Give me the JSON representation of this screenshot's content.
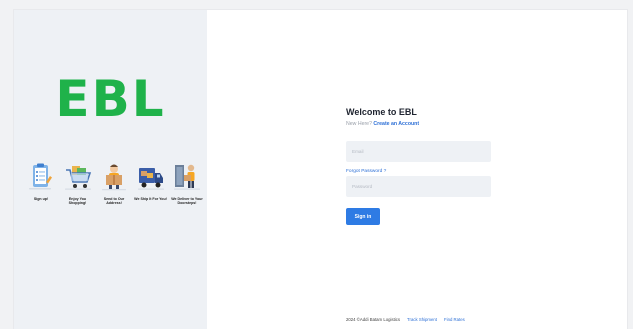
{
  "brand": {
    "logo_text": "EBL",
    "accent": "#1fb24a"
  },
  "steps": [
    {
      "icon": "clipboard-signup-icon",
      "label": "Sign up!"
    },
    {
      "icon": "shopping-cart-icon",
      "label": "Enjoy You Shopping!"
    },
    {
      "icon": "send-package-icon",
      "label": "Send to Our Address!"
    },
    {
      "icon": "delivery-truck-icon",
      "label": "We Ship It For You!"
    },
    {
      "icon": "delivery-person-icon",
      "label": "We Deliver to Your Doorsteps!"
    }
  ],
  "login": {
    "heading": "Welcome to EBL",
    "new_here": "New Here?",
    "create_account": "Create an Account",
    "email_placeholder": "Email",
    "forgot_password": "Forgot Password ?",
    "password_placeholder": "Password",
    "signin_label": "Sign in",
    "button_color": "#2e7be4"
  },
  "footer": {
    "copyright": "2024 ©Addi Batam Logistics",
    "track_shipment": "Track Shipment",
    "find_rates": "Find Rates"
  }
}
